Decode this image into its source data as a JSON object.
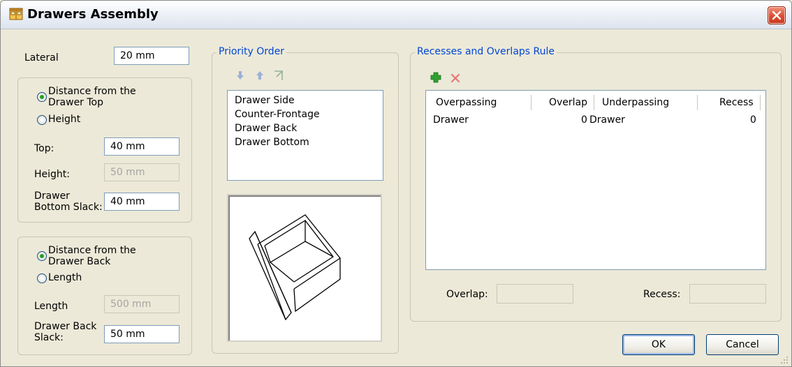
{
  "window": {
    "title": "Drawers Assembly",
    "icon": "drawer-assembly-icon",
    "close_icon": "close-icon"
  },
  "left": {
    "lateral_label": "Lateral",
    "lateral_value": "20 mm",
    "top_group": {
      "radio1_label_line1": "Distance from the",
      "radio1_label_line2": "Drawer Top",
      "radio1_selected": true,
      "radio2_label": "Height",
      "top_label": "Top:",
      "top_value": "40 mm",
      "height_label": "Height:",
      "height_value": "50 mm",
      "slack_label_line1": "Drawer",
      "slack_label_line2": "Bottom Slack:",
      "slack_value": "40 mm"
    },
    "back_group": {
      "radio1_label_line1": "Distance from the",
      "radio1_label_line2": "Drawer Back",
      "radio1_selected": true,
      "radio2_label": "Length",
      "length_label": "Length",
      "length_value": "500 mm",
      "slack_label_line1": "Drawer Back",
      "slack_label_line2": "Slack:",
      "slack_value": "50 mm"
    }
  },
  "priority": {
    "legend": "Priority Order",
    "items": [
      "Drawer Side",
      "Counter-Frontage",
      "Drawer Back",
      "Drawer Bottom"
    ]
  },
  "recesses": {
    "legend": "Recesses and Overlaps Rule",
    "columns": [
      "Overpassing",
      "Overlap",
      "Underpassing",
      "Recess"
    ],
    "rows": [
      {
        "overpassing": "Drawer",
        "overlap": "0",
        "underpassing": "Drawer",
        "recess": "0"
      }
    ],
    "overlap_label": "Overlap:",
    "overlap_value": "",
    "recess_label": "Recess:",
    "recess_value": ""
  },
  "buttons": {
    "ok": "OK",
    "cancel": "Cancel"
  },
  "colors": {
    "legend_blue": "#0046d5",
    "add_green": "#2ea02e",
    "delete_red": "#e04040"
  }
}
